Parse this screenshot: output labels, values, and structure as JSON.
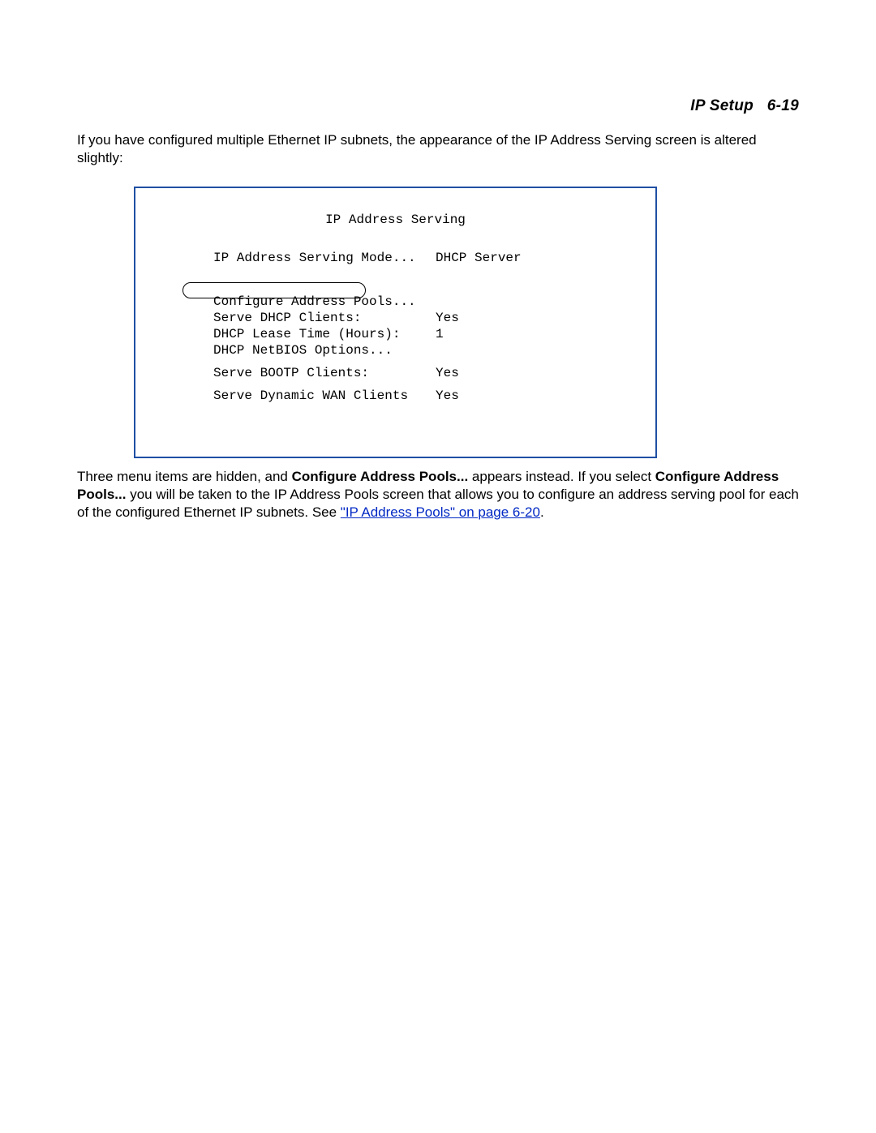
{
  "header": {
    "section": "IP Setup",
    "page": "6-19"
  },
  "intro": "If you have configured multiple Ethernet IP subnets, the appearance of the IP Address Serving screen is altered slightly:",
  "terminal": {
    "title": "IP Address Serving",
    "rows": [
      {
        "label": "IP Address Serving Mode...",
        "value": "DHCP Server"
      }
    ],
    "highlight_row": {
      "label": "Configure Address Pools...",
      "value": ""
    },
    "block2": [
      {
        "label": "Serve DHCP Clients:",
        "value": "Yes"
      },
      {
        "label": "DHCP Lease Time (Hours):",
        "value": "1"
      },
      {
        "label": "DHCP NetBIOS Options...",
        "value": ""
      }
    ],
    "block3": [
      {
        "label": "Serve BOOTP Clients:",
        "value": "Yes"
      }
    ],
    "block4": [
      {
        "label": "Serve Dynamic WAN Clients",
        "value": "Yes"
      }
    ]
  },
  "explain": {
    "pre1": "Three menu items are hidden, and ",
    "bold1": "Configure Address Pools...",
    "mid1": " appears instead. If you select ",
    "bold2": "Configure Address Pools...",
    "post1": " you will be taken to the IP Address Pools screen that allows you to configure an address serving pool for each of the configured Ethernet IP subnets. See ",
    "link_text": "\"IP Address Pools\" on page 6-20",
    "period": "."
  }
}
